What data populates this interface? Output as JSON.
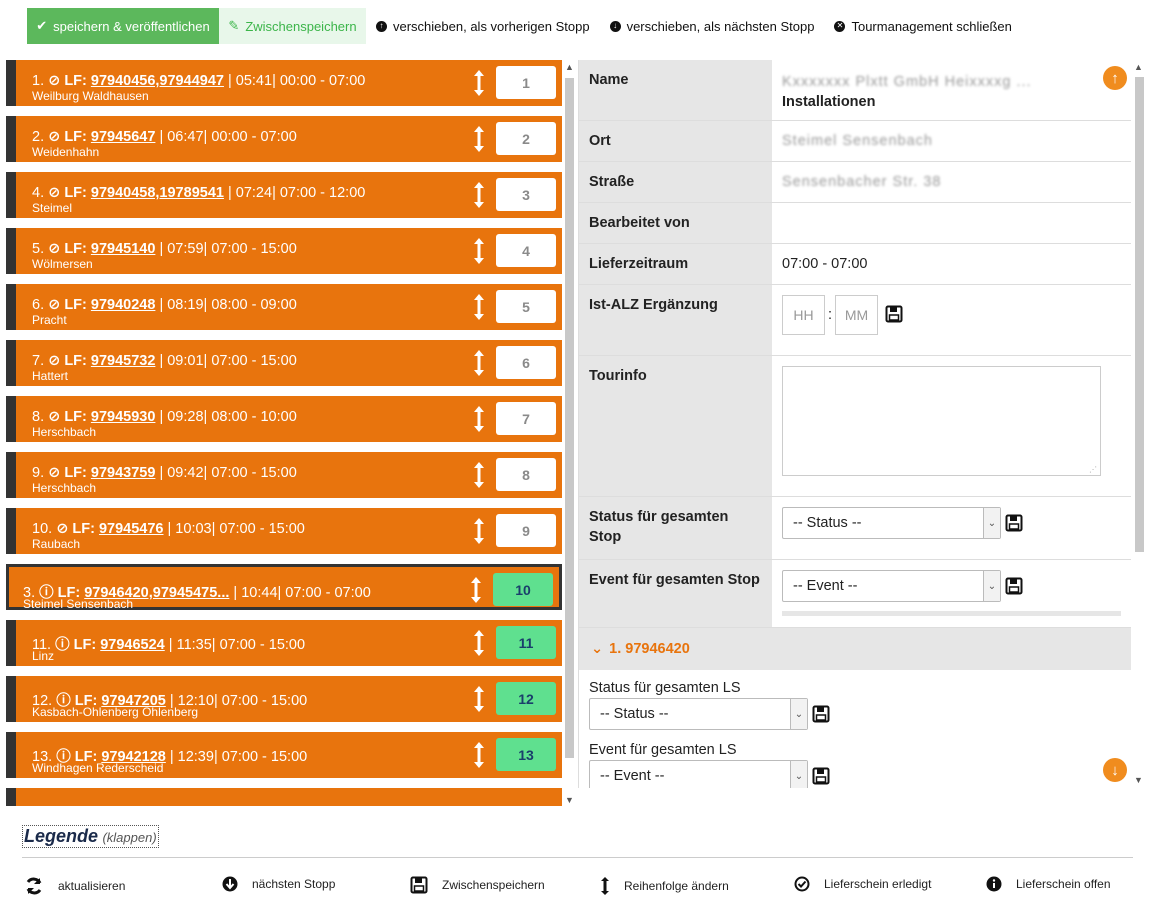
{
  "toolbar": {
    "publish_label": "speichern & veröffentlichen",
    "save_draft_label": "Zwischenspeichern",
    "move_prev_label": "verschieben, als vorherigen Stopp",
    "move_next_label": "verschieben, als nächsten Stopp",
    "close_label": "Tourmanagement schließen"
  },
  "stops": [
    {
      "prefix": "1.",
      "status": "done",
      "lf_label": "LF:",
      "lf": "97940456,97944947",
      "rest": "| 05:41| 00:00 - 07:00",
      "place": "Weilburg Waldhausen",
      "order": "1"
    },
    {
      "prefix": "2.",
      "status": "done",
      "lf_label": "LF:",
      "lf": "97945647",
      "rest": "| 06:47| 00:00 - 07:00",
      "place": "Weidenhahn",
      "order": "2"
    },
    {
      "prefix": "4.",
      "status": "done",
      "lf_label": "LF:",
      "lf": "97940458,19789541",
      "rest": "| 07:24| 07:00 - 12:00",
      "place": "Steimel",
      "order": "3"
    },
    {
      "prefix": "5.",
      "status": "done",
      "lf_label": "LF:",
      "lf": "97945140",
      "rest": "| 07:59| 07:00 - 15:00",
      "place": "Wölmersen",
      "order": "4"
    },
    {
      "prefix": "6.",
      "status": "done",
      "lf_label": "LF:",
      "lf": "97940248",
      "rest": "| 08:19| 08:00 - 09:00",
      "place": "Pracht",
      "order": "5"
    },
    {
      "prefix": "7.",
      "status": "done",
      "lf_label": "LF:",
      "lf": "97945732",
      "rest": "| 09:01| 07:00 - 15:00",
      "place": "Hattert",
      "order": "6"
    },
    {
      "prefix": "8.",
      "status": "done",
      "lf_label": "LF:",
      "lf": "97945930",
      "rest": "| 09:28| 08:00 - 10:00",
      "place": "Herschbach",
      "order": "7"
    },
    {
      "prefix": "9.",
      "status": "done",
      "lf_label": "LF:",
      "lf": "97943759",
      "rest": "| 09:42| 07:00 - 15:00",
      "place": "Herschbach",
      "order": "8"
    },
    {
      "prefix": "10.",
      "status": "done",
      "lf_label": "LF:",
      "lf": "97945476",
      "rest": "| 10:03| 07:00 - 15:00",
      "place": "Raubach",
      "order": "9"
    },
    {
      "prefix": "3.",
      "status": "open",
      "lf_label": "LF:",
      "lf": "97946420,97945475...",
      "rest": "| 10:44| 07:00 - 07:00",
      "place": "Steimel Sensenbach",
      "order": "10"
    },
    {
      "prefix": "11.",
      "status": "open",
      "lf_label": "LF:",
      "lf": "97946524",
      "rest": "| 11:35| 07:00 - 15:00",
      "place": "Linz",
      "order": "11"
    },
    {
      "prefix": "12.",
      "status": "open",
      "lf_label": "LF:",
      "lf": "97947205",
      "rest": "| 12:10| 07:00 - 15:00",
      "place": "Kasbach-Ohlenberg Ohlenberg",
      "order": "12"
    },
    {
      "prefix": "13.",
      "status": "open",
      "lf_label": "LF:",
      "lf": "97942128",
      "rest": "| 12:39| 07:00 - 15:00",
      "place": "Windhagen Rederscheid",
      "order": "13"
    }
  ],
  "detail": {
    "name_label": "Name",
    "name_line1": "Kxxxxxxx Plxtt GmbH Heixxxxg ...",
    "name_line2": "Installationen",
    "ort_label": "Ort",
    "ort_value": "Steimel Sensenbach",
    "strasse_label": "Straße",
    "strasse_value": "Sensenbacher Str. 38",
    "bearbeitet_label": "Bearbeitet von",
    "lieferzeitraum_label": "Lieferzeitraum",
    "lieferzeitraum_value": "07:00 - 07:00",
    "ist_alz_label": "Ist-ALZ Ergänzung",
    "hh_placeholder": "HH",
    "mm_placeholder": "MM",
    "time_sep": ":",
    "tourinfo_label": "Tourinfo",
    "status_stop_label": "Status für gesamten Stop",
    "status_select": "-- Status --",
    "event_stop_label": "Event für gesamten Stop",
    "event_select": "-- Event --",
    "section_title": "1. 97946420",
    "status_ls_label": "Status für gesamten LS",
    "status_ls_select": "-- Status --",
    "event_ls_label": "Event für gesamten LS",
    "event_ls_select": "-- Event --"
  },
  "legend": {
    "title": "Legende",
    "toggle": "(klappen)",
    "items": [
      {
        "icon": "refresh-icon",
        "label": "aktualisieren"
      },
      {
        "icon": "arrow-down-circle-icon",
        "label": "nächsten Stopp"
      },
      {
        "icon": "floppy-disk-icon",
        "label": "Zwischenspeichern"
      },
      {
        "icon": "vertical-arrows-icon",
        "label": "Reihenfolge ändern"
      },
      {
        "icon": "check-circle-icon",
        "label": "Lieferschein erledigt"
      },
      {
        "icon": "info-circle-icon",
        "label": "Lieferschein offen"
      }
    ]
  },
  "colors": {
    "stop_bg": "#e8740d",
    "accent_green": "#5cb85c",
    "order_green": "#5fe08f",
    "orange_button": "#f08c1e"
  }
}
